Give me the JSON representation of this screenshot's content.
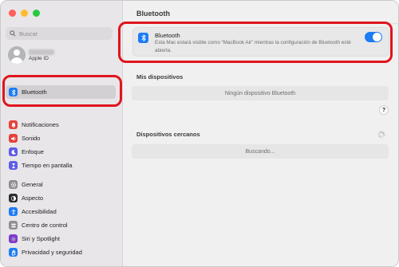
{
  "sidebar": {
    "search_placeholder": "Buscar",
    "account_label": "Apple ID",
    "selected_item": {
      "label": "Bluetooth",
      "icon": "bluetooth-icon",
      "color": "#1c7cf4"
    },
    "items": [
      {
        "label": "Notificaciones",
        "icon": "bell-icon",
        "color": "#e6423a"
      },
      {
        "label": "Sonido",
        "icon": "speaker-icon",
        "color": "#e6423a"
      },
      {
        "label": "Enfoque",
        "icon": "moon-icon",
        "color": "#5e5ce6"
      },
      {
        "label": "Tiempo en pantalla",
        "icon": "hourglass-icon",
        "color": "#5e5ce6"
      },
      {
        "label": "General",
        "icon": "gear-icon",
        "color": "#8e8e93"
      },
      {
        "label": "Aspecto",
        "icon": "appearance-icon",
        "color": "#2c2c2e"
      },
      {
        "label": "Accesibilidad",
        "icon": "accessibility-icon",
        "color": "#1c7cf4"
      },
      {
        "label": "Centro de control",
        "icon": "control-center-icon",
        "color": "#8e8e93"
      },
      {
        "label": "Siri y Spotlight",
        "icon": "siri-icon",
        "color": "#7a3bd1"
      },
      {
        "label": "Privacidad y seguridad",
        "icon": "hand-icon",
        "color": "#1c7cf4"
      }
    ]
  },
  "main": {
    "title": "Bluetooth",
    "bluetooth": {
      "name": "Bluetooth",
      "description": "Esta Mac estará visible como “MacBook Air” mientras la configuración de Bluetooth esté abierta.",
      "enabled": true
    },
    "my_devices": {
      "title": "Mis dispositivos",
      "empty_text": "Ningún dispositivo Bluetooth"
    },
    "help_label": "?",
    "nearby": {
      "title": "Dispositivos cercanos",
      "status": "Buscando..."
    }
  },
  "colors": {
    "accent": "#1c7cf4",
    "annotation": "#e0141e"
  }
}
